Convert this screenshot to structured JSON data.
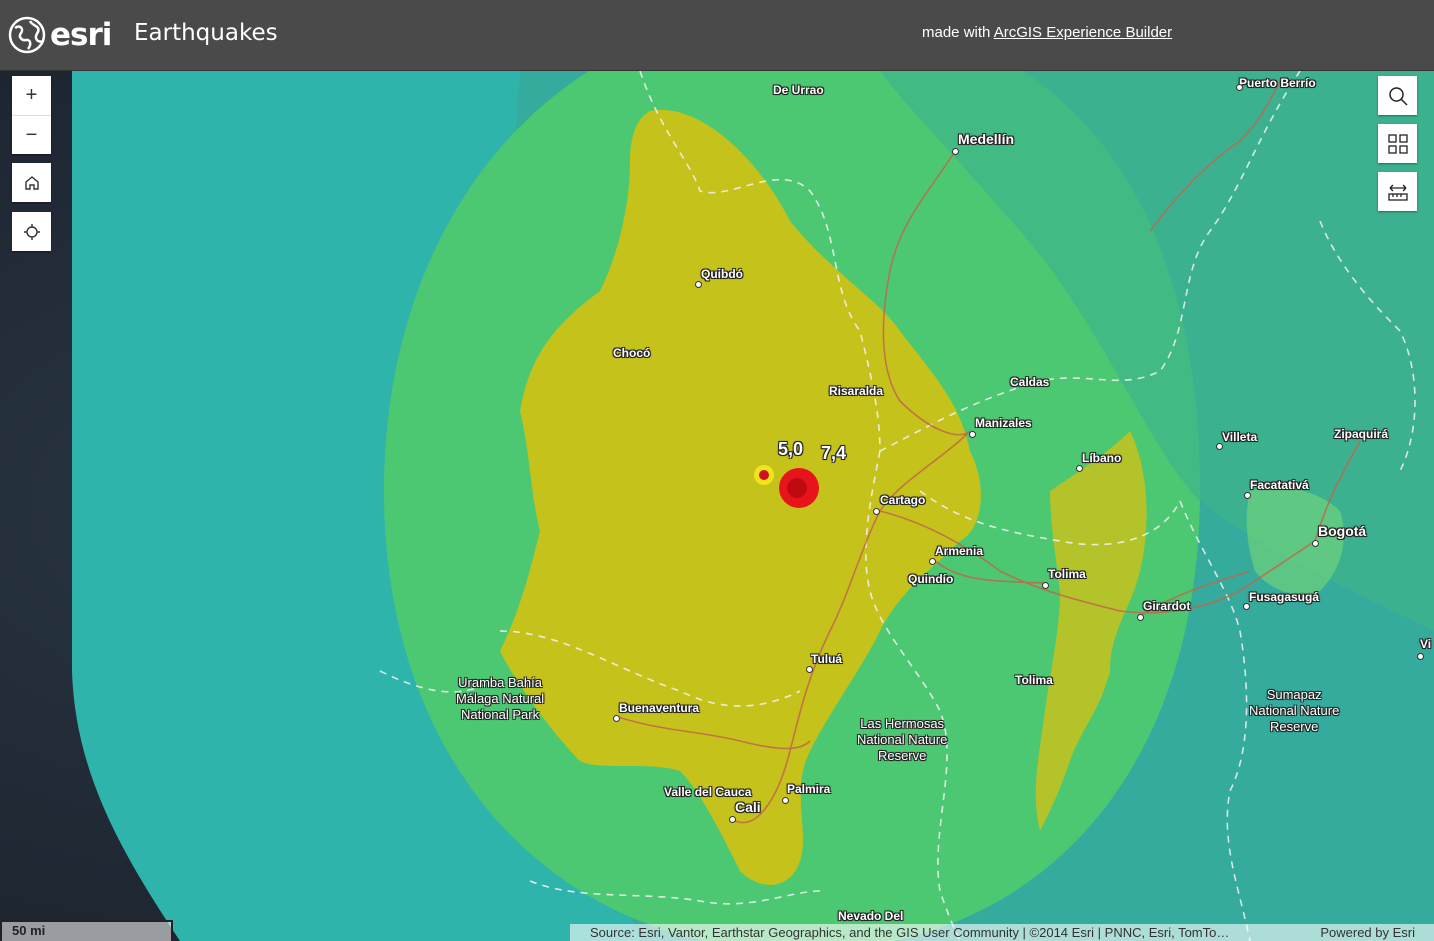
{
  "header": {
    "brand": "esri",
    "title": "Earthquakes",
    "credit_prefix": "made with",
    "credit_link": "ArcGIS Experience Builder"
  },
  "map": {
    "scale_label": "50 mi",
    "attribution": "Source: Esri, Vantor, Earthstar Geographics, and the GIS User Community | ©2014 Esri | PNNC, Esri, TomTo…",
    "powered_by": "Powered by Esri",
    "colors": {
      "ocean": "#1c2530",
      "outer_zone": "#2eb7ad",
      "middle_zone": "#45c97a",
      "inner_zone": "#c9c41e",
      "land": "#3aa8a0",
      "quake_large": "#e8141c",
      "quake_small": "#f2e41a"
    },
    "earthquakes": [
      {
        "label": "5,0",
        "magnitude": 5.0
      },
      {
        "label": "7,4",
        "magnitude": 7.4
      }
    ],
    "places": {
      "de_urrao": "De Urrao",
      "puerto_berrio": "Puerto Berrío",
      "medellin": "Medellín",
      "quibdo": "Quibdó",
      "choco": "Chocó",
      "risaralda": "Risaralda",
      "caldas": "Caldas",
      "manizales": "Manizales",
      "villeta": "Villeta",
      "zipaquira": "Zipaquirá",
      "libano": "Líbano",
      "facatativa": "Facatativá",
      "cartago": "Cartago",
      "bogota": "Bogotá",
      "armenia": "Armenia",
      "quindio": "Quindío",
      "tolima_1": "Tolima",
      "fusagasuga": "Fusagasugá",
      "girardot": "Girardot",
      "vi": "Vi",
      "tulua": "Tuluá",
      "tolima_2": "Tolima",
      "uramba": "Uramba Bahía\nMálaga Natural\nNational Park",
      "buenaventura": "Buenaventura",
      "sumapaz": "Sumapaz\nNational Nature\nReserve",
      "las_hermosas": "Las Hermosas\nNational Nature\nReserve",
      "valle_del_cauca": "Valle del Cauca",
      "palmira": "Palmira",
      "cali": "Cali",
      "nevado_del": "Nevado Del"
    }
  },
  "controls": {
    "zoom_in": "+",
    "zoom_out": "−"
  }
}
